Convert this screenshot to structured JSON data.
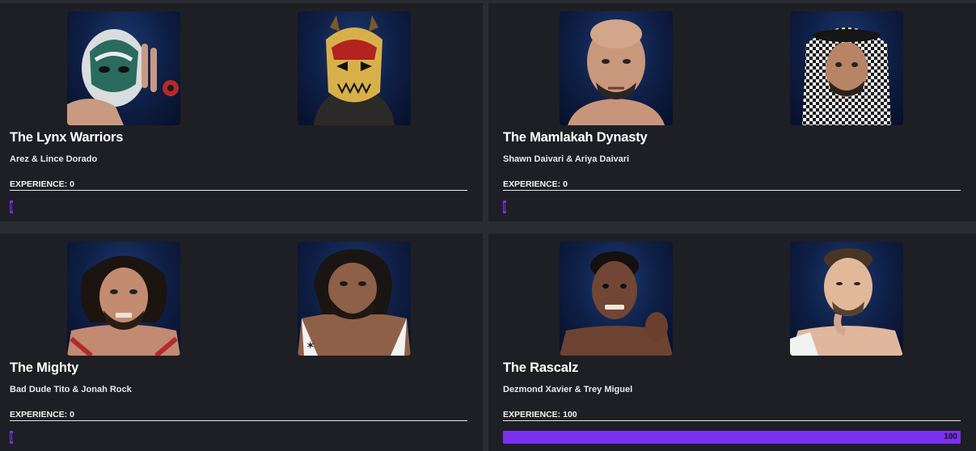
{
  "accent_color": "#7b2ff0",
  "teams": [
    {
      "name": "The Lynx Warriors",
      "members": "Arez & Lince Dorado",
      "experience_label": "EXPERIENCE: 0",
      "experience_value": 0,
      "experience_bar_text": "",
      "wrestlers": [
        "masked-wrestler-portrait",
        "gold-mask-wrestler-portrait"
      ]
    },
    {
      "name": "The Mamlakah Dynasty",
      "members": "Shawn Daivari & Ariya Daivari",
      "experience_label": "EXPERIENCE: 0",
      "experience_value": 0,
      "experience_bar_text": "",
      "wrestlers": [
        "bald-wrestler-portrait",
        "keffiyeh-wrestler-portrait"
      ]
    },
    {
      "name": "The Mighty",
      "members": "Bad Dude Tito & Jonah Rock",
      "experience_label": "EXPERIENCE: 0",
      "experience_value": 0,
      "experience_bar_text": "",
      "wrestlers": [
        "curly-hair-wrestler-portrait",
        "bearded-wrestler-portrait"
      ]
    },
    {
      "name": "The Rascalz",
      "members": "Dezmond Xavier & Trey Miguel",
      "experience_label": "EXPERIENCE: 100",
      "experience_value": 100,
      "experience_bar_text": "100",
      "wrestlers": [
        "fist-wrestler-portrait",
        "pose-wrestler-portrait"
      ]
    }
  ]
}
